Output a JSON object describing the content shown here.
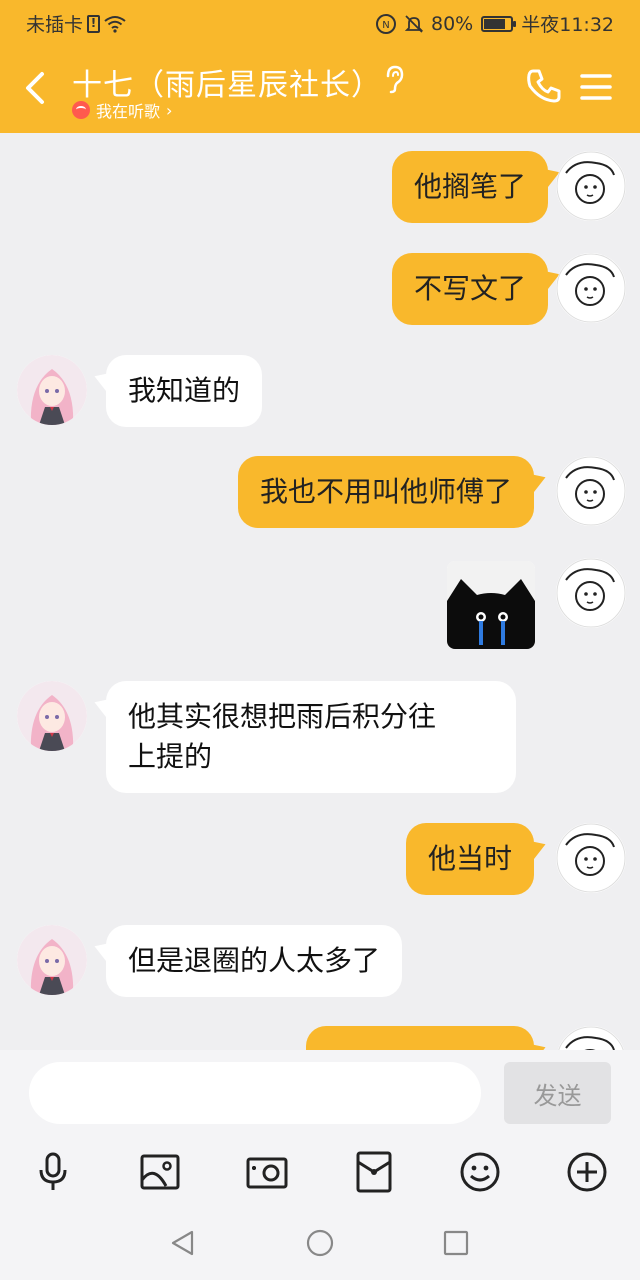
{
  "status_bar": {
    "carrier": "未插卡",
    "battery_percent": "80%",
    "battery_level": 0.8,
    "time": "半夜11:32",
    "icons": [
      "sim-alert-icon",
      "wifi-icon",
      "nfc-icon",
      "mute-icon",
      "battery-icon"
    ]
  },
  "header": {
    "title": "十七（雨后星辰社长）",
    "subtitle": "我在听歌",
    "subtitle_chevron": "›"
  },
  "messages": [
    {
      "side": "me",
      "type": "text",
      "text": "他搁笔了"
    },
    {
      "side": "me",
      "type": "text",
      "text": "不写文了"
    },
    {
      "side": "them",
      "type": "text",
      "text": "我知道的"
    },
    {
      "side": "me",
      "type": "text",
      "text": "我也不用叫他师傅了"
    },
    {
      "side": "me",
      "type": "sticker",
      "sticker": "crying-black-cat"
    },
    {
      "side": "them",
      "type": "text",
      "lines": [
        "他其实很想把雨后积分往",
        "上提的"
      ]
    },
    {
      "side": "me",
      "type": "text",
      "text": "他当时"
    },
    {
      "side": "them",
      "type": "text",
      "text": "但是退圈的人太多了"
    },
    {
      "side": "me",
      "type": "text",
      "text": ""
    }
  ],
  "composer": {
    "placeholder": "",
    "send_label": "发送"
  },
  "toolbar": [
    "microphone-icon",
    "image-icon",
    "camera-icon",
    "red-packet-icon",
    "emoji-icon",
    "plus-icon"
  ],
  "system_nav": [
    "back-triangle-icon",
    "home-circle-icon",
    "recents-square-icon"
  ],
  "colors": {
    "accent": "#f9b82c",
    "background": "#efeff1",
    "bubble_them": "#ffffff"
  }
}
